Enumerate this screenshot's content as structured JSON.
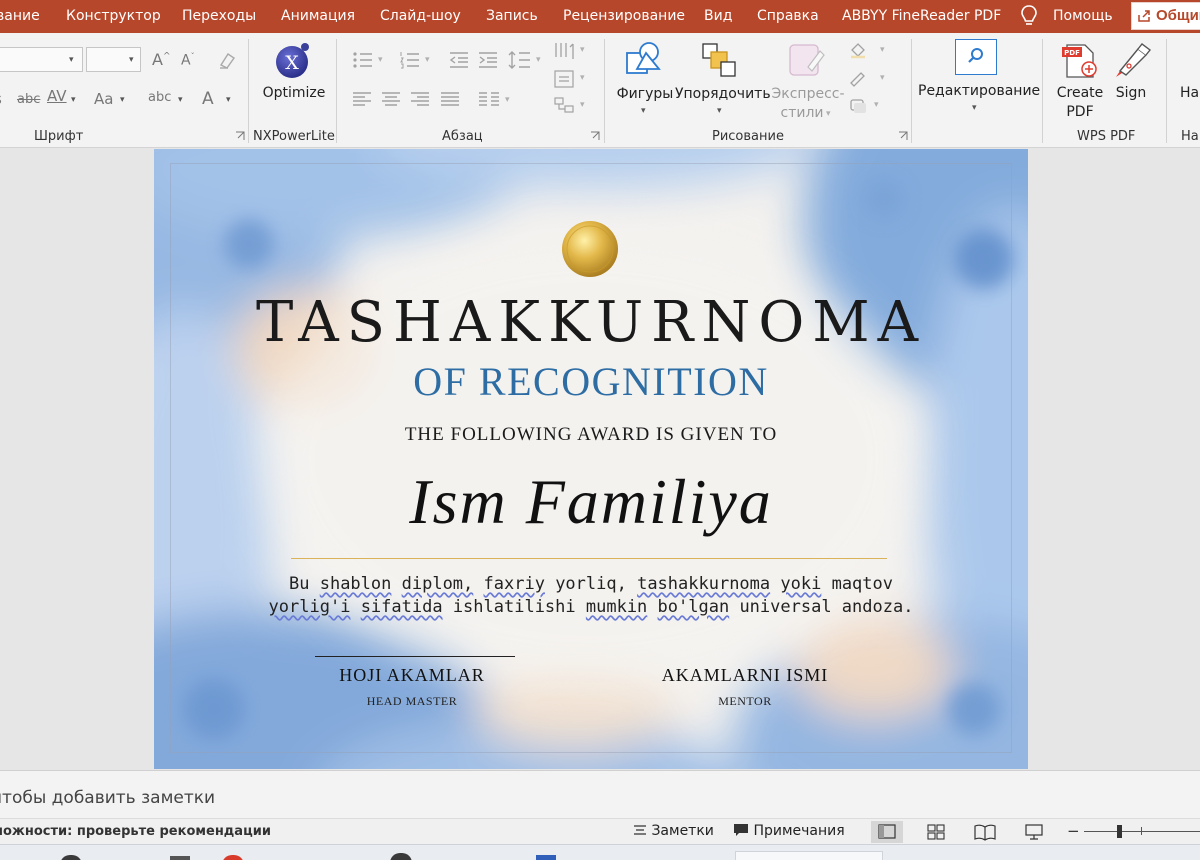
{
  "tabs": {
    "t0": "вание",
    "t1": "Конструктор",
    "t2": "Переходы",
    "t3": "Анимация",
    "t4": "Слайд-шоу",
    "t5": "Запись",
    "t6": "Рецензирование",
    "t7": "Вид",
    "t8": "Справка",
    "t9": "ABBYY FineReader PDF",
    "help": "Помощь",
    "share": "Общий"
  },
  "colors": {
    "title_bar": "#b7472a",
    "ribbon": "#f3f3f3",
    "subtitle_blue": "#2e6da4",
    "gold_line": "#d9b25a"
  },
  "ribbon": {
    "groups": {
      "font": "Шрифт",
      "nxpowerlite": "NXPowerLite",
      "paragraph": "Абзац",
      "drawing": "Рисование",
      "wps_pdf": "WPS PDF",
      "cut": "На"
    },
    "buttons": {
      "optimize": "Optimize",
      "shapes": "Фигуры",
      "arrange": "Упорядочить",
      "quick_styles_1": "Экспресс-",
      "quick_styles_2": "стили",
      "editing": "Редактирование",
      "create_pdf_1": "Create",
      "create_pdf_2": "PDF",
      "sign": "Sign",
      "cut_label": "На",
      "abc_label": "abc",
      "av_label": "AV",
      "aa_label": "Aa",
      "abc2_label": "abc",
      "a_label": "A",
      "pdf_badge": "PDF",
      "nx_letter": "X"
    }
  },
  "slide": {
    "title": "TASHAKKURNOMA",
    "subtitle": "OF RECOGNITION",
    "award_text": "THE FOLLOWING AWARD IS GIVEN TO",
    "recipient": "Ism Familiya",
    "desc_line1_a": "Bu ",
    "desc_line1_b": "shablon",
    "desc_line1_c": " ",
    "desc_line1_d": "diplom,",
    "desc_line1_e": " ",
    "desc_line1_f": "faxriy",
    "desc_line1_g": " yorliq, ",
    "desc_line1_h": "tashakkurnoma",
    "desc_line1_i": " ",
    "desc_line1_j": "yoki",
    "desc_line1_k": " maqtov",
    "desc_line2_a": "yorlig'i",
    "desc_line2_b": " ",
    "desc_line2_c": "sifatida",
    "desc_line2_d": " ishlatilishi ",
    "desc_line2_e": "mumkin",
    "desc_line2_f": " ",
    "desc_line2_g": "bo'lgan",
    "desc_line2_h": " universal andoza.",
    "signer1_name": "HOJI AKAMLAR",
    "signer1_role": "HEAD MASTER",
    "signer2_name": "AKAMLARNI ISMI",
    "signer2_role": "MENTOR"
  },
  "notes": {
    "placeholder": "чтобы добавить заметки"
  },
  "status": {
    "accessibility": "ножности: проверьте рекомендации",
    "notes_btn": "Заметки",
    "comments_btn": "Примечания"
  }
}
